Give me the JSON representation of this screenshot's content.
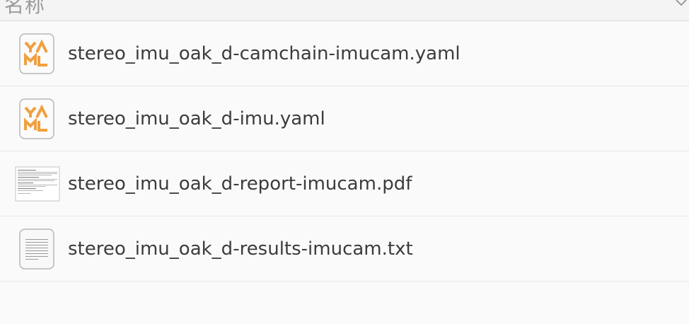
{
  "header": {
    "name_column_label": "名称"
  },
  "files": [
    {
      "name": "stereo_imu_oak_d-camchain-imucam.yaml",
      "icon": "yaml-file-icon"
    },
    {
      "name": "stereo_imu_oak_d-imu.yaml",
      "icon": "yaml-file-icon"
    },
    {
      "name": "stereo_imu_oak_d-report-imucam.pdf",
      "icon": "pdf-thumbnail-icon"
    },
    {
      "name": "stereo_imu_oak_d-results-imucam.txt",
      "icon": "text-file-icon"
    }
  ],
  "colors": {
    "yaml_accent": "#f0a040",
    "text": "#3c3c3c"
  }
}
